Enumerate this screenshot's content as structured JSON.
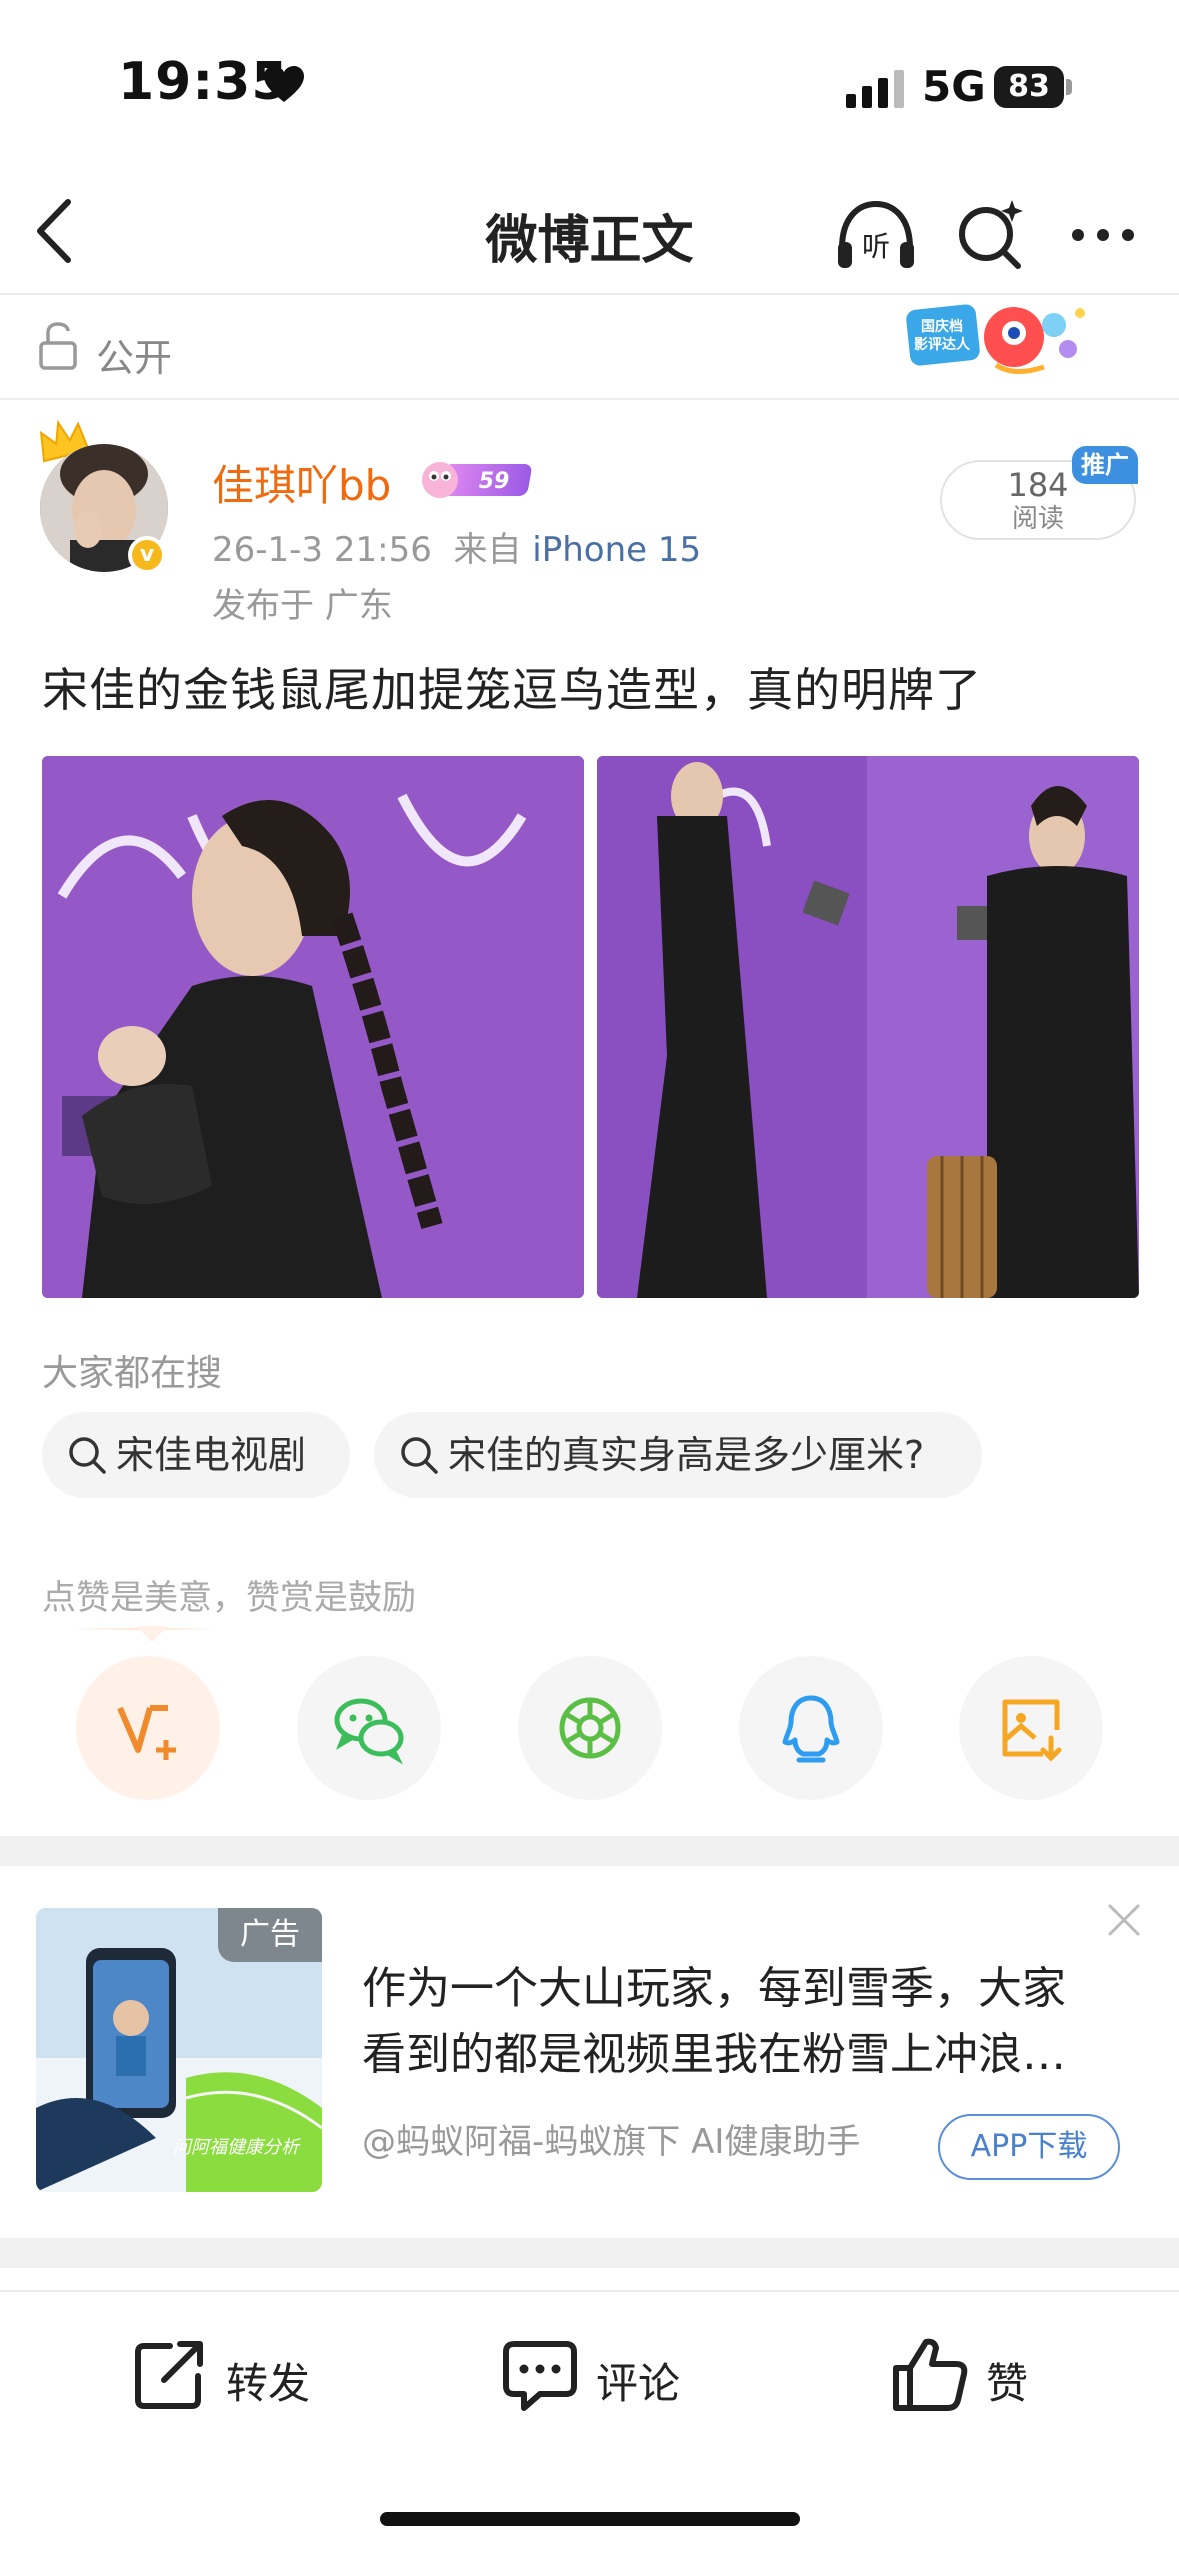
{
  "status_bar": {
    "time": "19:35",
    "network": "5G",
    "battery": "83"
  },
  "nav": {
    "title": "微博正文"
  },
  "visibility": {
    "label": "公开",
    "badge_text": "国庆档影评达人"
  },
  "post": {
    "username": "佳琪吖bb",
    "level": "59",
    "timestamp": "26-1-3 21:56",
    "source_prefix": "来自",
    "source": "iPhone 15",
    "location": "发布于 广东",
    "read_count": "184",
    "read_label": "阅读",
    "promo_tag": "推广",
    "text": "宋佳的金钱鼠尾加提笼逗鸟造型，真的明牌了"
  },
  "searches": {
    "heading": "大家都在搜",
    "chips": [
      "宋佳电视剧",
      "宋佳的真实身高是多少厘米?"
    ]
  },
  "praise": {
    "note": "点赞是美意，赞赏是鼓励"
  },
  "share_targets": [
    {
      "icon": "weibo-v-plus-icon"
    },
    {
      "icon": "wechat-icon"
    },
    {
      "icon": "moments-icon"
    },
    {
      "icon": "qq-icon"
    },
    {
      "icon": "save-image-icon"
    }
  ],
  "ad": {
    "tag": "广告",
    "title": "作为一个大山玩家，每到雪季，大家看到的都是视频里我在粉雪上冲浪…",
    "source": "@蚂蚁阿福-蚂蚁旗下 AI健康助手",
    "button": "APP下载",
    "image_caption": "问阿福健康分析"
  },
  "bottom_bar": {
    "repost": "转发",
    "comment": "评论",
    "like": "赞"
  },
  "colors": {
    "username": "#f06a0f",
    "link": "#4a6fa5",
    "ad_button": "#4a80cc",
    "promo": "#3d8fe0"
  }
}
